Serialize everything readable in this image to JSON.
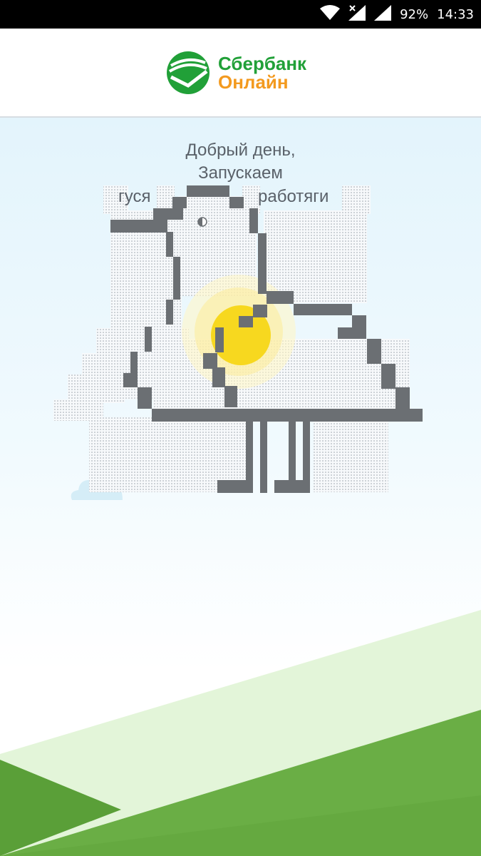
{
  "status_bar": {
    "battery": "92%",
    "time": "14:33",
    "icons": [
      "wifi-icon",
      "signal-x-icon",
      "signal-icon"
    ]
  },
  "header": {
    "brand_line1": "Сбербанк",
    "brand_line2": "Онлайн",
    "colors": {
      "brand_green": "#21a038",
      "brand_orange": "#f39a1f"
    }
  },
  "main": {
    "greeting_line1": "Добрый день,",
    "greeting_line2": "Запускаем",
    "greeting_word_left": "гуся",
    "greeting_word_right": "работяги"
  }
}
